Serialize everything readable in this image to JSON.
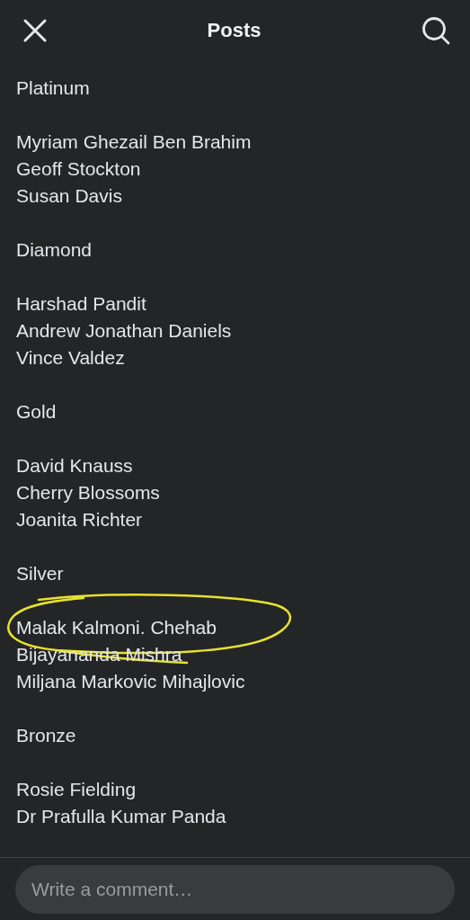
{
  "header": {
    "title": "Posts"
  },
  "groups": [
    {
      "tier": "Platinum",
      "names": [
        {
          "name": "Myriam Ghezail Ben Brahim",
          "circled": false
        },
        {
          "name": "Geoff Stockton",
          "circled": false
        },
        {
          "name": "Susan Davis",
          "circled": false
        }
      ]
    },
    {
      "tier": "Diamond",
      "names": [
        {
          "name": "Harshad Pandit",
          "circled": false
        },
        {
          "name": "Andrew Jonathan Daniels",
          "circled": false
        },
        {
          "name": "Vince Valdez",
          "circled": false
        }
      ]
    },
    {
      "tier": "Gold",
      "names": [
        {
          "name": "David Knauss",
          "circled": false
        },
        {
          "name": "Cherry Blossoms",
          "circled": false
        },
        {
          "name": "Joanita Richter",
          "circled": false
        }
      ]
    },
    {
      "tier": "Silver",
      "names": [
        {
          "name": "Malak Kalmoni. Chehab",
          "circled": true
        },
        {
          "name": "Bijayananda Mishra",
          "circled": false
        },
        {
          "name": "Miljana Markovic Mihajlovic",
          "circled": false
        }
      ]
    },
    {
      "tier": "Bronze",
      "names": [
        {
          "name": "Rosie Fielding",
          "circled": false
        },
        {
          "name": "Dr Prafulla Kumar Panda",
          "circled": false
        }
      ]
    }
  ],
  "comment": {
    "placeholder": "Write a comment…"
  }
}
